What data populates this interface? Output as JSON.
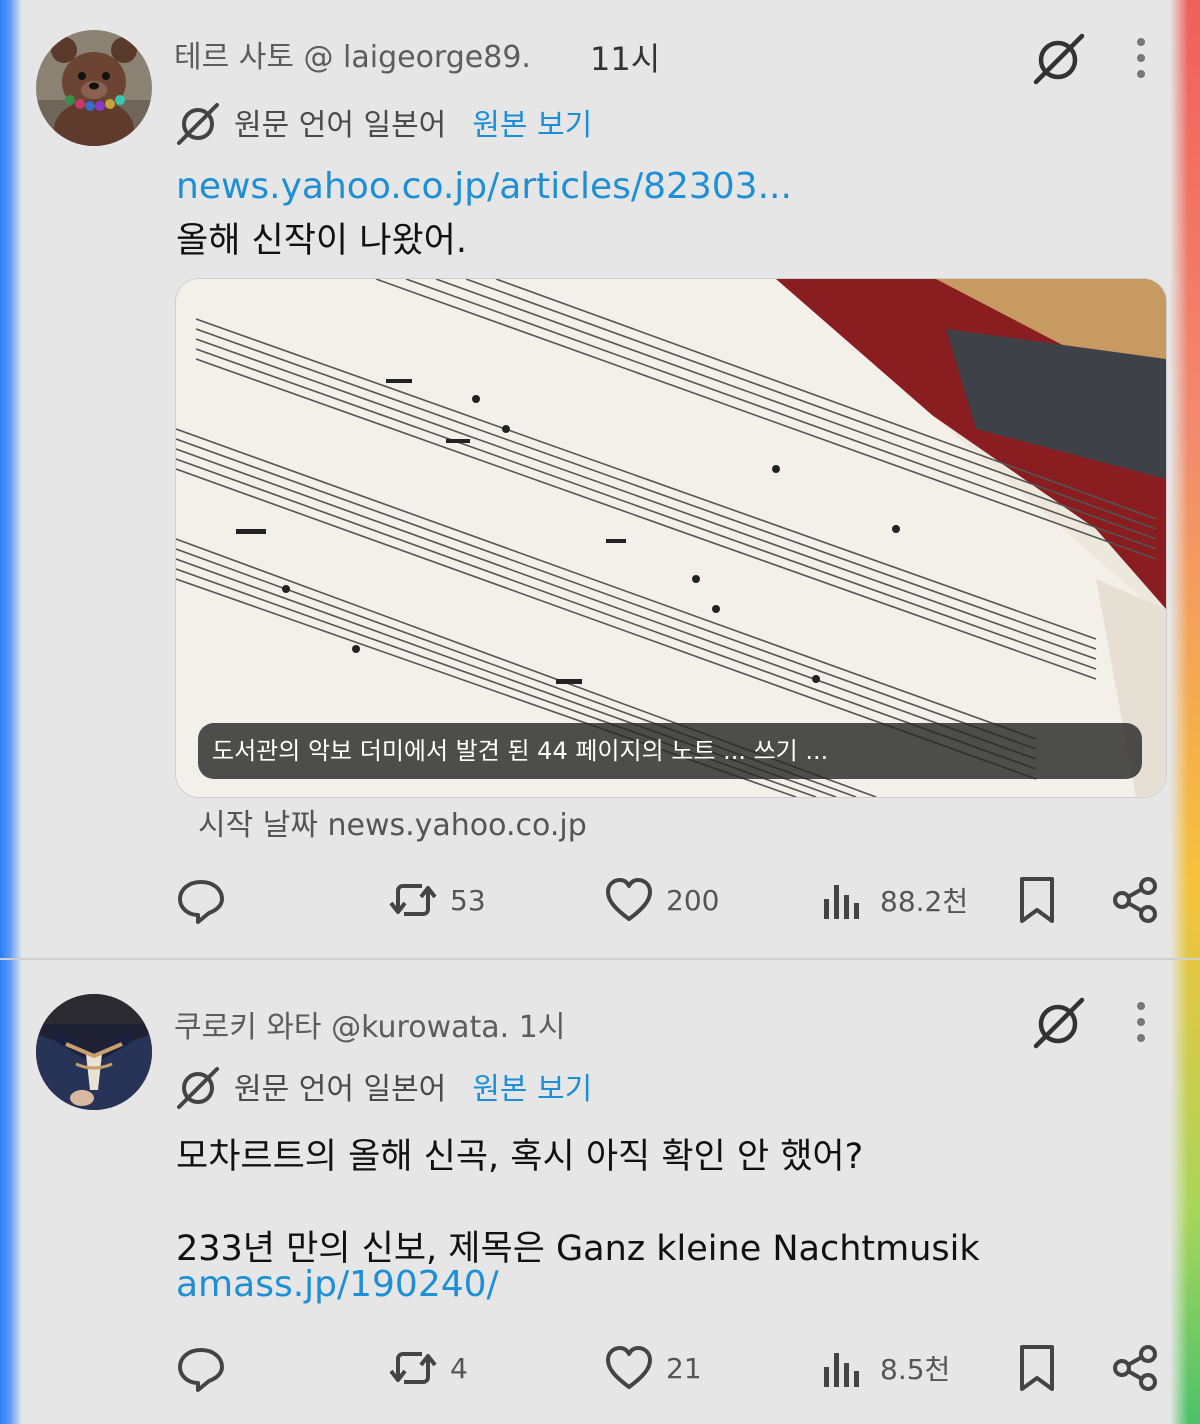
{
  "posts": [
    {
      "display_name": "테르 사토",
      "handle": "@ laigeorge89.",
      "time": "11시",
      "translation": {
        "lang_text": "원문 언어 일본어",
        "original_link": "원본 보기"
      },
      "link": "news.yahoo.co.jp/articles/82303...",
      "text": "올해 신작이 나왔어.",
      "card": {
        "caption": "도서관의 악보 더미에서 발견 된 44 페이지의 노트 ... 쓰기 ...",
        "source": "시작 날짜 news.yahoo.co.jp"
      },
      "actions": {
        "retweets": "53",
        "likes": "200",
        "views": "88.2천"
      }
    },
    {
      "display_name": "쿠로키 와타",
      "handle": "@kurowata.",
      "time": "1시",
      "translation": {
        "lang_text": "원문 언어 일본어",
        "original_link": "원본 보기"
      },
      "text_line1": "모차르트의 올해 신곡, 혹시 아직 확인 안 했어?",
      "text_line2": "233년 만의 신보, 제목은 Ganz kleine Nachtmusik",
      "link": "amass.jp/190240/",
      "actions": {
        "retweets": "4",
        "likes": "21",
        "views": "8.5천"
      }
    }
  ],
  "icons": [
    "grok-icon",
    "more-vertical-icon",
    "translate-icon",
    "reply-icon",
    "retweet-icon",
    "like-icon",
    "views-icon",
    "bookmark-icon",
    "share-icon"
  ],
  "colors": {
    "link": "#1d8fd6",
    "background": "#e6e6e6",
    "meta_text": "#5d5d5d"
  }
}
